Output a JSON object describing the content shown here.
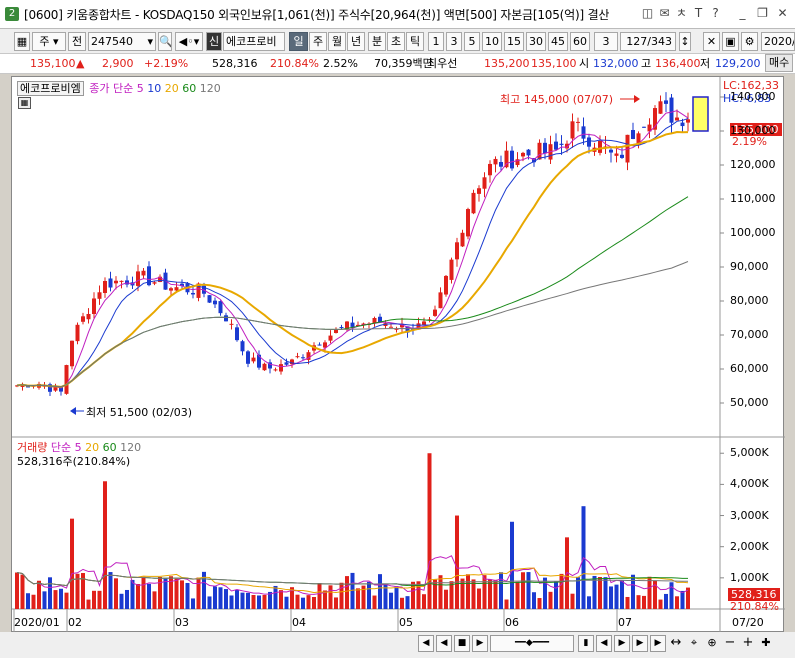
{
  "window": {
    "icon": "2",
    "title": "[0600] 키움종합차트 - KOSDAQ150 외국인보유[1,061(천)] 주식수[20,964(천)] 액면[500] 자본금[105(억)] 결산",
    "buttons": [
      "◫",
      "✉",
      "ㅊ",
      "T",
      "?",
      "_",
      "❐",
      "✕"
    ]
  },
  "toolbar": {
    "type_sel": "주",
    "side": "전",
    "code": "247540",
    "market_badge": "신",
    "stock_name": "에코프로비",
    "periods": [
      "일",
      "주",
      "월",
      "년",
      "분",
      "초",
      "틱"
    ],
    "minutes": [
      "1",
      "3",
      "5",
      "10",
      "15",
      "30",
      "45",
      "60"
    ],
    "min_sel": "3",
    "counter": "127/343",
    "date": "2020/"
  },
  "price": {
    "current": "135,100",
    "arrow": "▲",
    "change": "2,900",
    "pct": "+2.19%",
    "volume": "528,316",
    "vol_pct": "210.84%",
    "ratio": "2.52%",
    "amount": "70,359백만",
    "pref_label": "최우선",
    "ask": "135,200",
    "bid": "135,100",
    "open_label": "시",
    "open": "132,000",
    "high_label": "고",
    "high": "136,400",
    "low_label": "저",
    "low": "129,200",
    "side_btn": "매수"
  },
  "chart": {
    "legend_price": "에코프로비엠",
    "legend_ma_label": "종가 단순",
    "ma_periods": [
      "5",
      "10",
      "20",
      "60",
      "120"
    ],
    "lc": "LC:162,33",
    "hc": "HC:-6,83",
    "last_price": "135,100",
    "last_pct": "2.19%",
    "high_ann": "최고 145,000 (07/07)",
    "low_ann": "최저 51,500 (02/03)",
    "yticks": [
      "140,000",
      "130,000",
      "120,000",
      "110,000",
      "100,000",
      "90,000",
      "80,000",
      "70,000",
      "60,000",
      "50,000"
    ],
    "vol_legend": "거래량",
    "vol_ma_label": "단순",
    "vol_ma_periods": [
      "5",
      "20",
      "60",
      "120"
    ],
    "vol_info": "528,316주(210.84%)",
    "vticks": [
      "5,000K",
      "4,000K",
      "3,000K",
      "2,000K",
      "1,000K"
    ],
    "vol_last": "528,316",
    "vol_last_pct": "210.84%",
    "xticks": [
      "2020/01",
      "02",
      "03",
      "04",
      "05",
      "06",
      "07",
      "07/20"
    ]
  },
  "chart_data": {
    "type": "candlestick",
    "y_range": [
      45000,
      147000
    ],
    "vol_range": [
      0,
      5200000
    ]
  },
  "colors": {
    "up": "#e0201a",
    "down": "#1a3ad0",
    "ma5": "#c020c0",
    "ma10": "#1a3ad0",
    "ma20": "#e8a800",
    "ma60": "#1a8a1a",
    "ma120": "#777777"
  }
}
